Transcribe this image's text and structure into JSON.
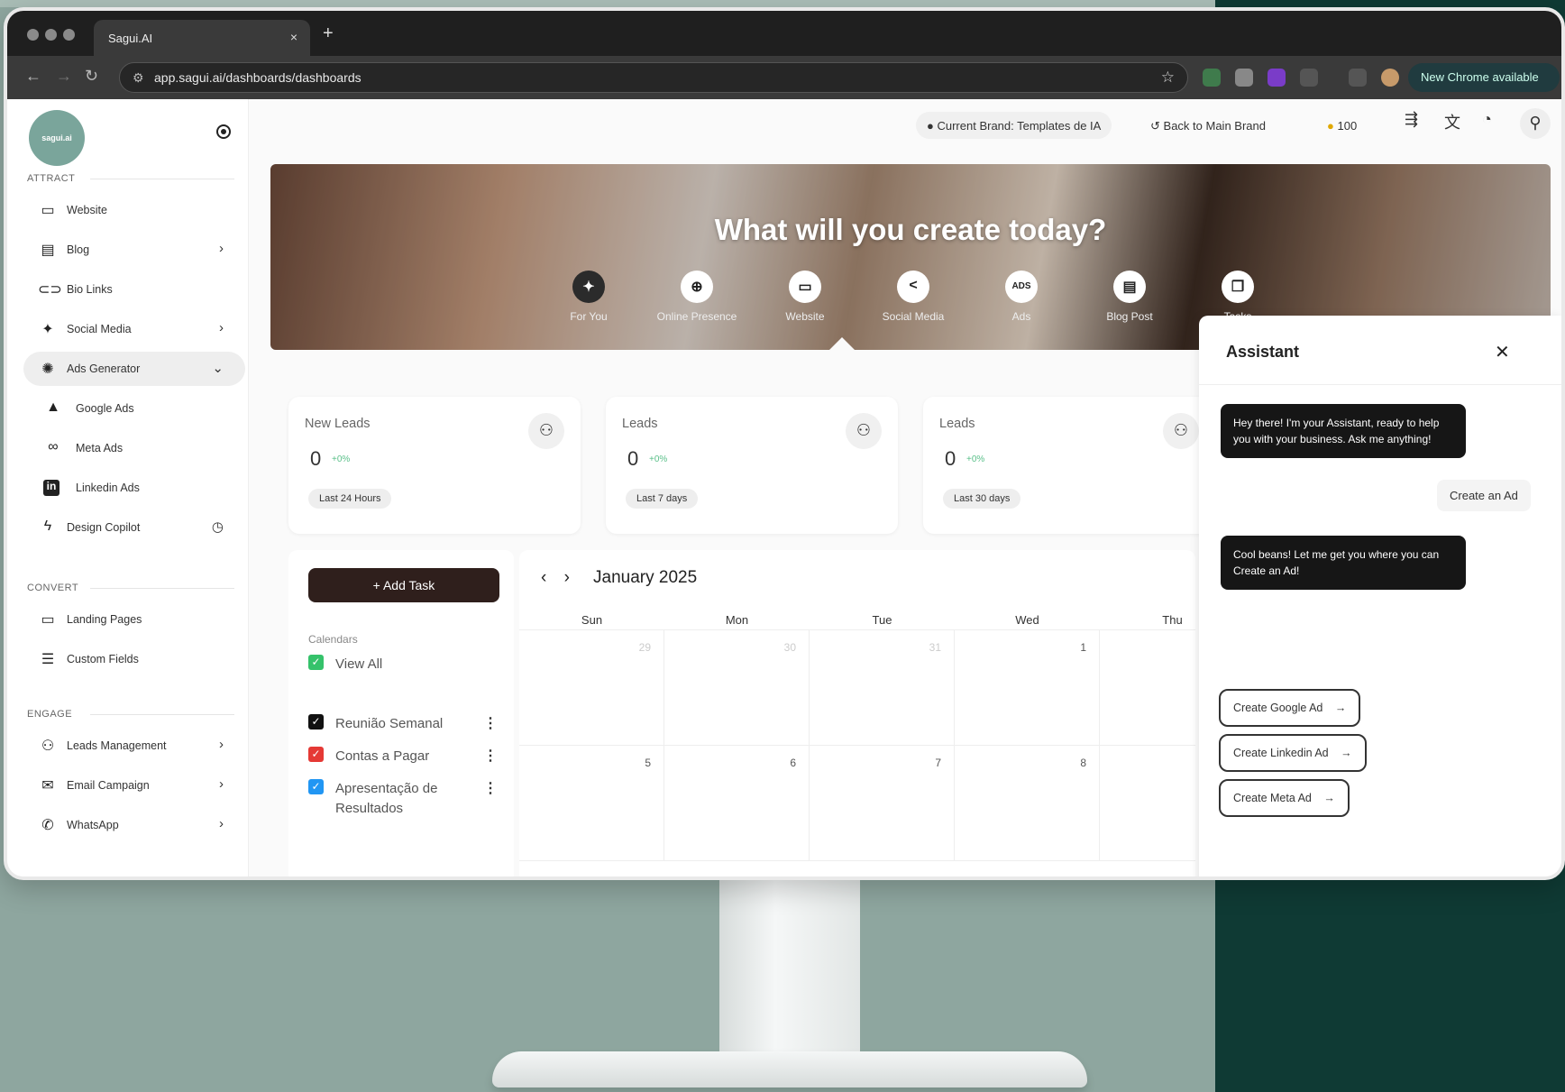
{
  "browser": {
    "tab_title": "Sagui.AI",
    "tab_close": "×",
    "new_tab": "+",
    "url": "app.sagui.ai/dashboards/dashboards",
    "update_label": "New Chrome available",
    "nav": {
      "back": "←",
      "forward": "→",
      "reload": "↻"
    }
  },
  "sidebar": {
    "logo_text": "sagui.ai",
    "sections": {
      "attract": "ATTRACT",
      "convert": "CONVERT",
      "engage": "ENGAGE"
    },
    "items": {
      "website": {
        "label": "Website",
        "icon": "monitor-icon"
      },
      "blog": {
        "label": "Blog",
        "icon": "document-icon"
      },
      "bio_links": {
        "label": "Bio Links",
        "icon": "link-icon"
      },
      "social_media": {
        "label": "Social Media",
        "icon": "sparkles-icon"
      },
      "ads_generator": {
        "label": "Ads Generator",
        "icon": "loader-icon"
      },
      "google_ads": {
        "label": "Google Ads",
        "icon": "google-ads-icon"
      },
      "meta_ads": {
        "label": "Meta Ads",
        "icon": "meta-icon"
      },
      "linkedin_ads": {
        "label": "Linkedin Ads",
        "icon": "linkedin-icon"
      },
      "design_copilot": {
        "label": "Design Copilot",
        "icon": "bolt-icon"
      },
      "landing_pages": {
        "label": "Landing Pages",
        "icon": "laptop-icon"
      },
      "custom_fields": {
        "label": "Custom Fields",
        "icon": "list-icon"
      },
      "leads_management": {
        "label": "Leads Management",
        "icon": "users-icon"
      },
      "email_campaign": {
        "label": "Email Campaign",
        "icon": "mail-icon"
      },
      "whatsapp": {
        "label": "WhatsApp",
        "icon": "whatsapp-icon"
      }
    }
  },
  "header": {
    "current_brand": "Current Brand: Templates de IA",
    "back_to_main": "Back to Main Brand",
    "credits": "100"
  },
  "hero": {
    "title": "What will you create today?",
    "categories": [
      {
        "label": "For You",
        "glyph": "✦"
      },
      {
        "label": "Online Presence",
        "glyph": "⊕"
      },
      {
        "label": "Website",
        "glyph": "▭"
      },
      {
        "label": "Social Media",
        "glyph": "<"
      },
      {
        "label": "Ads",
        "glyph": "ADS"
      },
      {
        "label": "Blog Post",
        "glyph": "▤"
      },
      {
        "label": "Tasks",
        "glyph": "❐"
      }
    ]
  },
  "stats": [
    {
      "title": "New Leads",
      "value": "0",
      "change": "+0%",
      "period": "Last 24 Hours"
    },
    {
      "title": "Leads",
      "value": "0",
      "change": "+0%",
      "period": "Last 7 days"
    },
    {
      "title": "Leads",
      "value": "0",
      "change": "+0%",
      "period": "Last 30 days"
    }
  ],
  "tasks": {
    "add_task": "+ Add Task",
    "calendars_heading": "Calendars",
    "view_all": "View All",
    "calendars": [
      {
        "label": "Reunião Semanal",
        "color": "#111111"
      },
      {
        "label": "Contas a Pagar",
        "color": "#e53935"
      },
      {
        "label": "Apresentação de Resultados",
        "color": "#2196f3"
      }
    ]
  },
  "calendar": {
    "month": "January 2025",
    "days": [
      "Sun",
      "Mon",
      "Tue",
      "Wed",
      "Thu"
    ],
    "week1": [
      "29",
      "30",
      "31",
      "1",
      ""
    ],
    "week2": [
      "5",
      "6",
      "7",
      "8",
      ""
    ]
  },
  "assistant": {
    "title": "Assistant",
    "close": "✕",
    "bot_msg_1": "Hey there! I'm your Assistant, ready to help you with your business. Ask me anything!",
    "user_msg": "Create an Ad",
    "bot_msg_2": "Cool beans! Let me get you where you can Create an Ad!",
    "actions": [
      "Create Google Ad",
      "Create Linkedin Ad",
      "Create Meta Ad"
    ]
  },
  "colors": {
    "accent_dark": "#2f1f1c",
    "positive": "#5bc08a",
    "background_teal": "#0f3a34",
    "background_sage": "#8ea69f"
  }
}
